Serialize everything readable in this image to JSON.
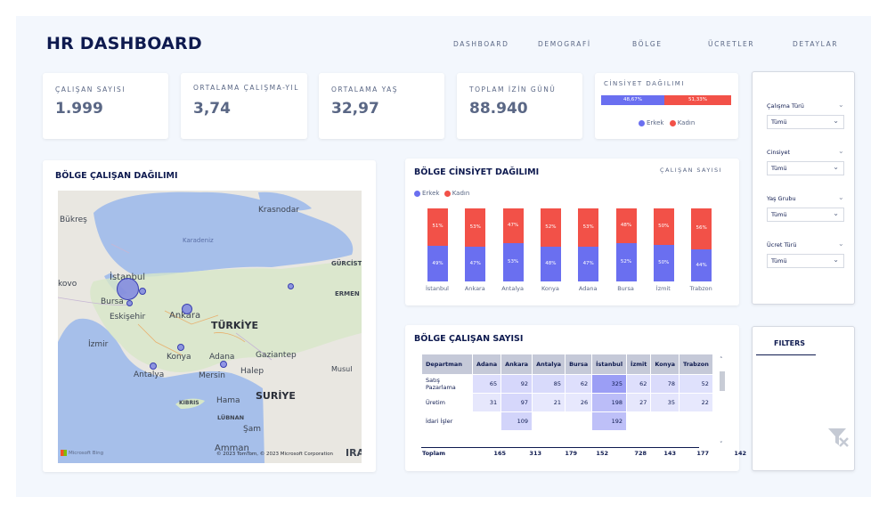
{
  "header": {
    "title": "HR DASHBOARD",
    "nav": [
      "DASHBOARD",
      "DEMOGRAFİ",
      "BÖLGE",
      "ÜCRETLER",
      "DETAYLAR"
    ]
  },
  "kpis": [
    {
      "label": "ÇALIŞAN SAYISI",
      "value": "1.999"
    },
    {
      "label": "ORTALAMA ÇALIŞMA-YIL",
      "value": "3,74"
    },
    {
      "label": "ORTALAMA YAŞ",
      "value": "32,97"
    },
    {
      "label": "TOPLAM İZİN GÜNÜ",
      "value": "88.940"
    }
  ],
  "gender_card": {
    "title": "CİNSİYET DAĞILIMI",
    "male_pct": 48.67,
    "female_pct": 51.33,
    "male_label": "48,67%",
    "female_label": "51,33%",
    "legend_male": "Erkek",
    "legend_female": "Kadın",
    "colors": {
      "male": "#6a6ff0",
      "female": "#f25148"
    }
  },
  "map_card": {
    "title": "BÖLGE ÇALIŞAN DAĞILIMI",
    "labels": {
      "sea": "Karadeniz",
      "bukres": "Bükreş",
      "krasnodar": "Krasnodar",
      "kovo": "kovo",
      "istanbul": "İstanbul",
      "bursa": "Bursa",
      "eskisehir": "Eskişehir",
      "ankara": "Ankara",
      "turkiye": "TÜRKİYE",
      "izmir": "İzmir",
      "konya": "Konya",
      "adana": "Adana",
      "antalya": "Antalya",
      "mersin": "Mersin",
      "gaziantep": "Gaziantep",
      "halep": "Halep",
      "musul": "Musul",
      "gurcistan": "GÜRCİST",
      "ermen": "ERMEN",
      "suriye": "SURİYE",
      "kibris": "KIBRIS",
      "hama": "Hama",
      "lubnan": "LÜBNAN",
      "sam": "Şam",
      "amman": "Amman",
      "ira": "IRA"
    },
    "bing": "Microsoft Bing",
    "copyright": "© 2023 TomTom, © 2023 Microsoft Corporation"
  },
  "gender_chart": {
    "title": "BÖLGE CİNSİYET DAĞILIMI",
    "subtitle": "ÇALIŞAN SAYISI",
    "legend_male": "Erkek",
    "legend_female": "Kadın"
  },
  "chart_data": {
    "type": "bar",
    "title": "BÖLGE CİNSİYET DAĞILIMI",
    "categories": [
      "İstanbul",
      "Ankara",
      "Antalya",
      "Konya",
      "Adana",
      "Bursa",
      "İzmit",
      "Trabzon"
    ],
    "series": [
      {
        "name": "Erkek",
        "values": [
          49,
          47,
          53,
          48,
          47,
          52,
          50,
          44
        ],
        "labels": [
          "49%",
          "47%",
          "53%",
          "48%",
          "47%",
          "52%",
          "50%",
          "44%"
        ]
      },
      {
        "name": "Kadın",
        "values": [
          51,
          53,
          47,
          52,
          53,
          48,
          50,
          56
        ],
        "labels": [
          "51%",
          "53%",
          "47%",
          "52%",
          "53%",
          "48%",
          "50%",
          "56%"
        ]
      }
    ],
    "stacked": true,
    "ylim": [
      0,
      100
    ]
  },
  "matrix": {
    "title": "BÖLGE ÇALIŞAN SAYISI",
    "columns": [
      "Departman",
      "Adana",
      "Ankara",
      "Antalya",
      "Bursa",
      "İstanbul",
      "İzmit",
      "Konya",
      "Trabzon"
    ],
    "rows": [
      {
        "name": "Satış Pazarlama",
        "values": [
          "65",
          "92",
          "85",
          "62",
          "325",
          "62",
          "78",
          "52"
        ]
      },
      {
        "name": "Üretim",
        "values": [
          "31",
          "97",
          "21",
          "26",
          "198",
          "27",
          "35",
          "22"
        ]
      },
      {
        "name": "İdari İşler",
        "values": [
          "",
          "109",
          "",
          "",
          "192",
          "",
          "",
          ""
        ]
      }
    ],
    "total": {
      "name": "Toplam",
      "values": [
        "165",
        "313",
        "179",
        "152",
        "728",
        "143",
        "177",
        "142"
      ]
    }
  },
  "slicers": [
    {
      "label": "Çalışma Türü",
      "value": "Tümü"
    },
    {
      "label": "Cinsiyet",
      "value": "Tümü"
    },
    {
      "label": "Yaş Grubu",
      "value": "Tümü"
    },
    {
      "label": "Ücret Türü",
      "value": "Tümü"
    }
  ],
  "filters": {
    "title": "FILTERS"
  }
}
